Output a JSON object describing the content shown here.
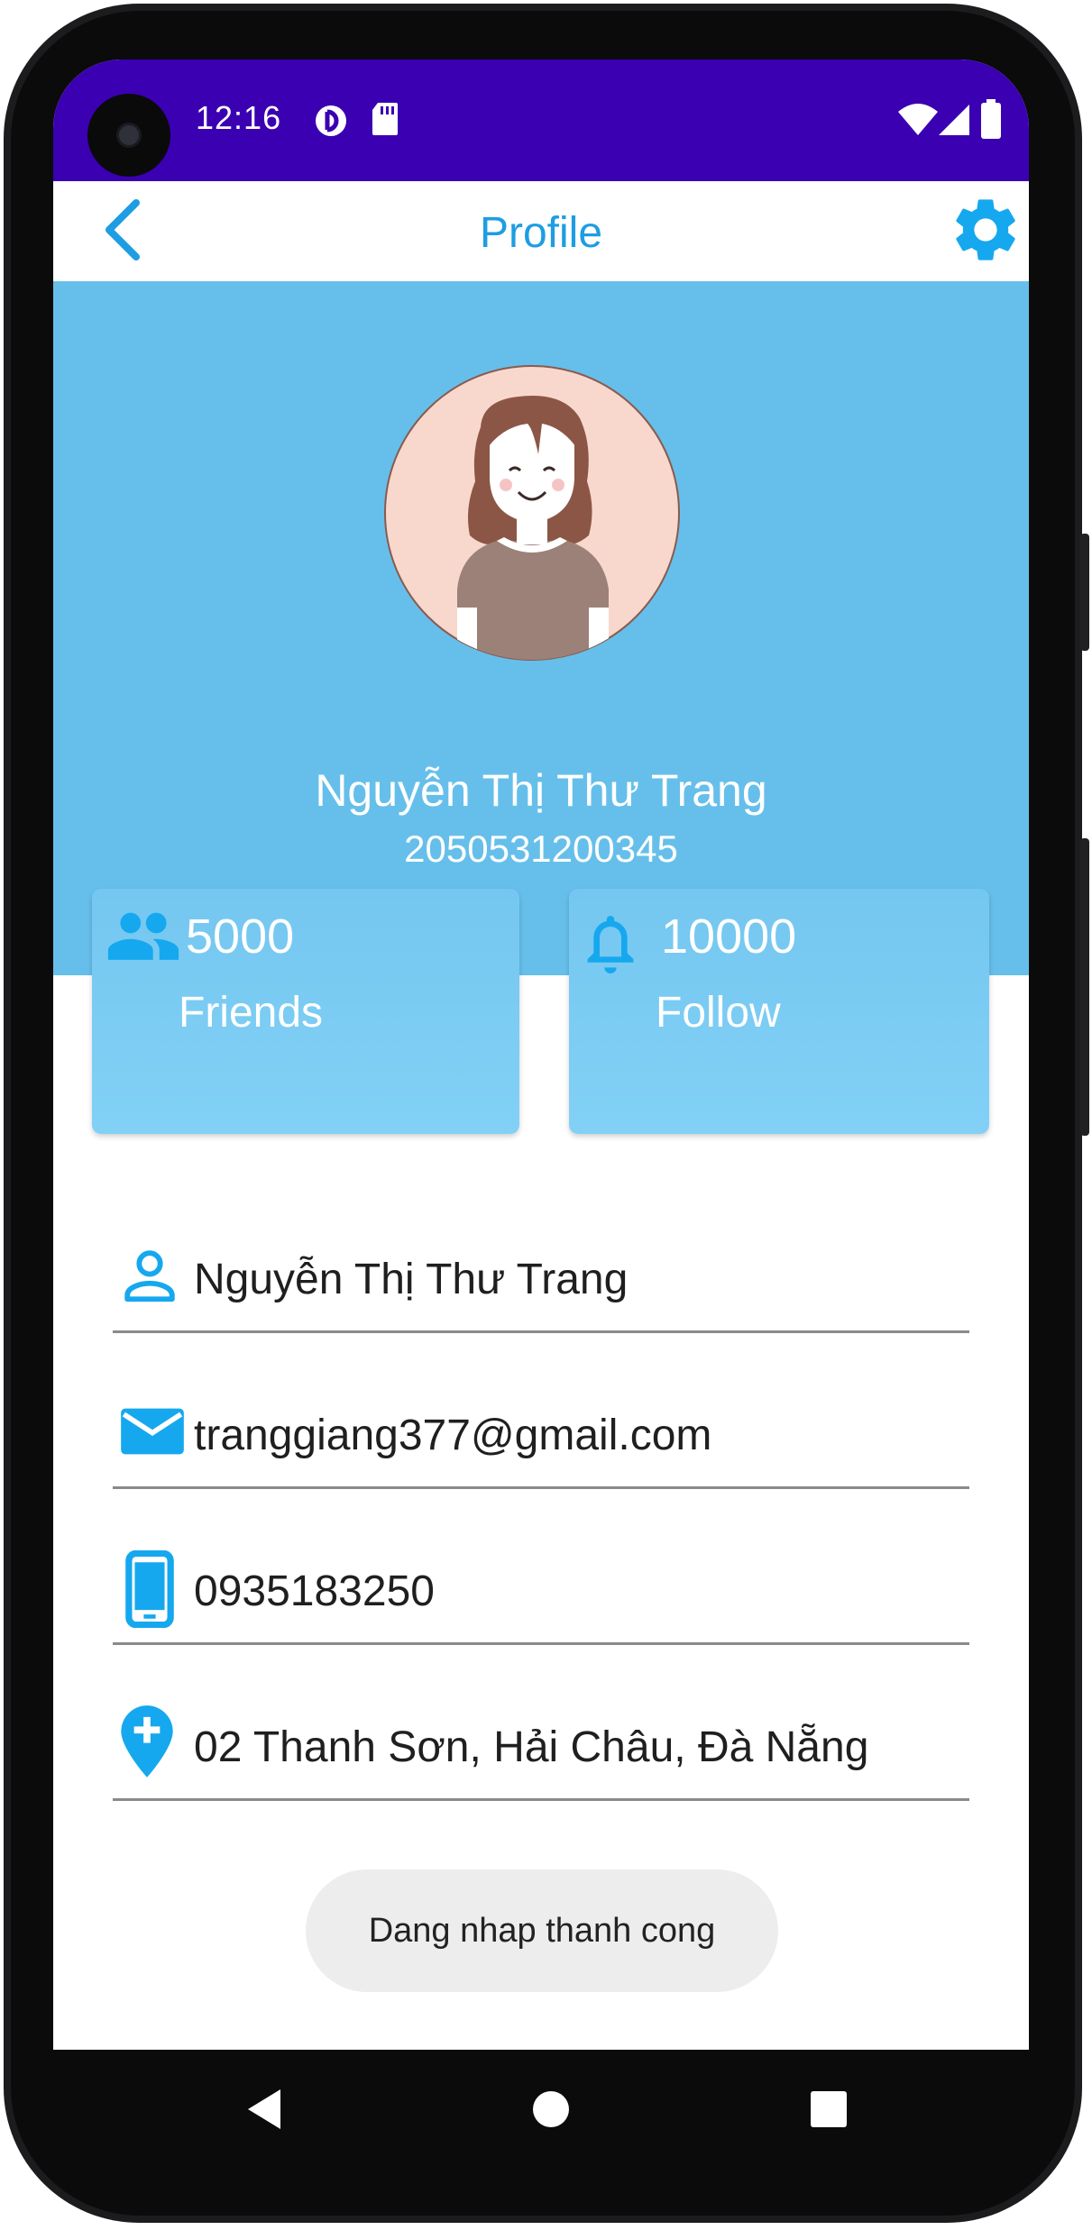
{
  "status_bar": {
    "time": "12:16",
    "icons": [
      "camera-punch-hole",
      "data-saver-icon",
      "sd-card-icon",
      "wifi-icon",
      "cell-signal-icon",
      "battery-icon"
    ]
  },
  "toolbar": {
    "back_icon": "chevron-left-icon",
    "title": "Profile",
    "settings_icon": "gear-icon"
  },
  "profile": {
    "name": "Nguyễn Thị Thư Trang",
    "id": "2050531200345",
    "avatar": "female-avatar-illustration"
  },
  "stats": [
    {
      "icon": "people-icon",
      "value": "5000",
      "label": "Friends"
    },
    {
      "icon": "bell-icon",
      "value": "10000",
      "label": "Follow"
    }
  ],
  "info": [
    {
      "icon": "person-icon",
      "value": "Nguyễn Thị Thư Trang"
    },
    {
      "icon": "email-icon",
      "value": "tranggiang377@gmail.com"
    },
    {
      "icon": "phone-icon",
      "value": "0935183250"
    },
    {
      "icon": "location-icon",
      "value": "02 Thanh Sơn, Hải Châu, Đà Nẵng"
    }
  ],
  "toast": "Dang nhap thanh cong",
  "navigation_bar": [
    "back-icon",
    "home-icon",
    "overview-icon"
  ],
  "colors": {
    "status_bar": "#3a00b2",
    "accent": "#1e9de3",
    "header": "#66bfea",
    "card": "#7ccbf3",
    "icon_blue": "#16a8ee"
  }
}
